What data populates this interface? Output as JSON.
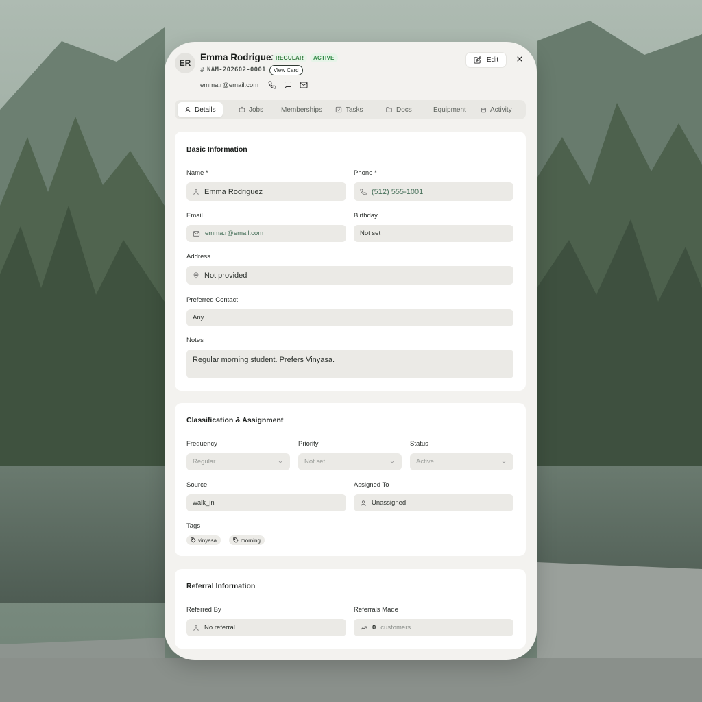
{
  "customer": {
    "initials": "ER",
    "name": "Emma Rodriguez",
    "badges": {
      "frequency": "REGULAR",
      "status": "ACTIVE"
    },
    "id": "NAM-202602-0001",
    "view_card_label": "View Card",
    "email": "emma.r@email.com"
  },
  "header": {
    "edit_label": "Edit",
    "icons": [
      "phone-icon",
      "message-icon",
      "mail-icon",
      "edit-icon",
      "close-icon"
    ]
  },
  "tabs": [
    {
      "label": "Details",
      "icon": "user-icon",
      "active": true
    },
    {
      "label": "Jobs",
      "icon": "briefcase-icon"
    },
    {
      "label": "Memberships"
    },
    {
      "label": "Tasks",
      "icon": "checkbox-icon"
    },
    {
      "label": "Docs",
      "icon": "folder-icon"
    },
    {
      "label": "Equipment"
    },
    {
      "label": "Activity",
      "icon": "calendar-icon"
    }
  ],
  "basic": {
    "title": "Basic Information",
    "name_label": "Name *",
    "name_value": "Emma Rodriguez",
    "phone_label": "Phone *",
    "phone_value": "(512) 555-1001",
    "email_label": "Email",
    "email_value": "emma.r@email.com",
    "birthday_label": "Birthday",
    "birthday_value": "Not set",
    "address_label": "Address",
    "address_value": "Not provided",
    "pref_label": "Preferred Contact",
    "pref_value": "Any",
    "notes_label": "Notes",
    "notes_value": "Regular morning student. Prefers Vinyasa."
  },
  "classification": {
    "title": "Classification & Assignment",
    "frequency_label": "Frequency",
    "frequency_value": "Regular",
    "priority_label": "Priority",
    "priority_value": "Not set",
    "status_label": "Status",
    "status_value": "Active",
    "source_label": "Source",
    "source_value": "walk_in",
    "assigned_label": "Assigned To",
    "assigned_value": "Unassigned",
    "tags_label": "Tags",
    "tags": [
      "vinyasa",
      "morning"
    ]
  },
  "referral": {
    "title": "Referral Information",
    "referred_by_label": "Referred By",
    "referred_by_value": "No referral",
    "referrals_made_label": "Referrals Made",
    "referrals_count": "0",
    "referrals_unit": "customers"
  },
  "colors": {
    "panel": "#f3f2ef",
    "field": "#ebeae6",
    "badge_green": "#2f7a3a"
  }
}
